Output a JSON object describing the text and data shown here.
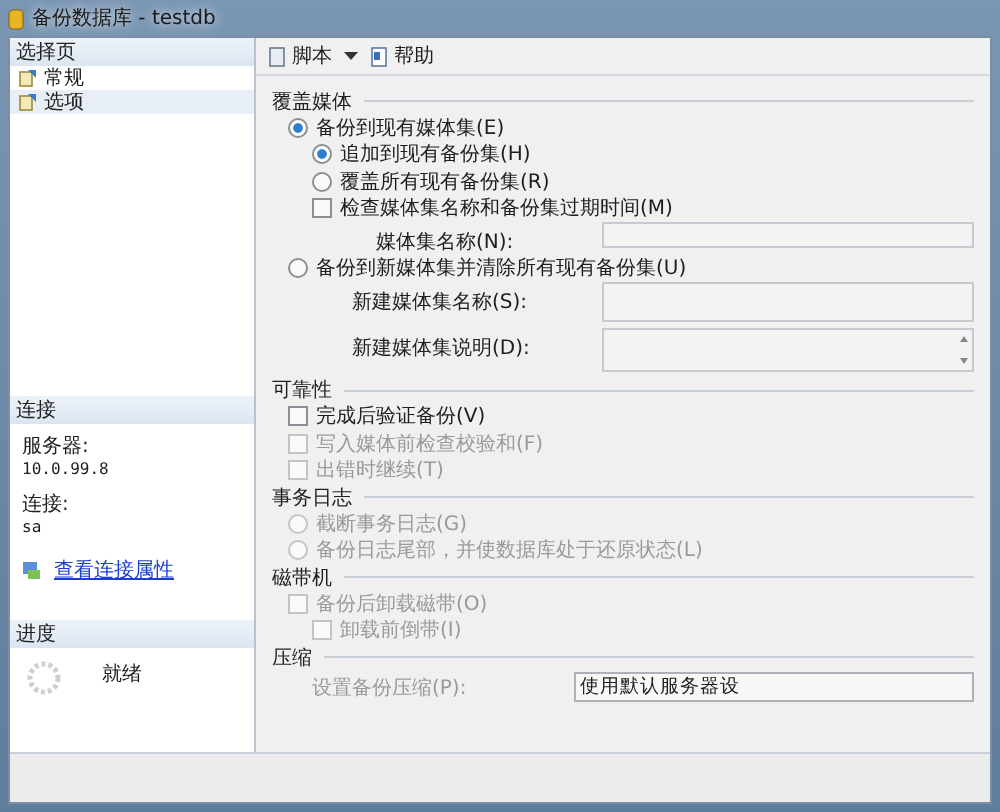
{
  "window": {
    "title": "备份数据库 - testdb"
  },
  "sidebar": {
    "header": "选择页",
    "items": [
      {
        "label": "常规",
        "selected": false
      },
      {
        "label": "选项",
        "selected": true
      }
    ]
  },
  "connection": {
    "header": "连接",
    "server_label": "服务器:",
    "server": "10.0.99.8",
    "login_label": "连接:",
    "login": "sa",
    "link": "查看连接属性"
  },
  "progress": {
    "header": "进度",
    "status": "就绪"
  },
  "toolbar": [
    {
      "label": "脚本",
      "kind": "script",
      "dropdown": true
    },
    {
      "label": "帮助",
      "kind": "help",
      "dropdown": false
    }
  ],
  "sections": [
    {
      "title": "覆盖媒体",
      "items": [
        {
          "kind": "radio",
          "label": "备份到现有媒体集(E)",
          "selected": true,
          "disabled": false,
          "children": [
            {
              "kind": "radio",
              "label": "追加到现有备份集(H)",
              "selected": true,
              "disabled": false
            },
            {
              "kind": "radio",
              "label": "覆盖所有现有备份集(R)",
              "selected": false,
              "disabled": false
            },
            {
              "kind": "checkbox",
              "label": "检查媒体集名称和备份集过期时间(M)",
              "checked": false,
              "disabled": false,
              "children": [
                {
                  "kind": "field",
                  "label": "媒体集名称(N):",
                  "disabled": true
                }
              ]
            }
          ]
        },
        {
          "kind": "radio",
          "label": "备份到新媒体集并清除所有现有备份集(U)",
          "selected": false,
          "disabled": false,
          "children": [
            {
              "kind": "field",
              "label": "新建媒体集名称(S):",
              "disabled": true,
              "tall": true
            },
            {
              "kind": "textarea",
              "label": "新建媒体集说明(D):",
              "disabled": true
            }
          ]
        }
      ]
    },
    {
      "title": "可靠性",
      "items": [
        {
          "kind": "checkbox",
          "label": "完成后验证备份(V)",
          "checked": false,
          "disabled": false
        },
        {
          "kind": "checkbox",
          "label": "写入媒体前检查校验和(F)",
          "checked": false,
          "disabled": true
        },
        {
          "kind": "checkbox",
          "label": "出错时继续(T)",
          "checked": false,
          "disabled": true
        }
      ]
    },
    {
      "title": "事务日志",
      "items": [
        {
          "kind": "radio",
          "label": "截断事务日志(G)",
          "selected": false,
          "disabled": true
        },
        {
          "kind": "radio",
          "label": "备份日志尾部，并使数据库处于还原状态(L)",
          "selected": false,
          "disabled": true
        }
      ]
    },
    {
      "title": "磁带机",
      "items": [
        {
          "kind": "checkbox",
          "label": "备份后卸载磁带(O)",
          "checked": false,
          "disabled": true,
          "children": [
            {
              "kind": "checkbox",
              "label": "卸载前倒带(I)",
              "checked": false,
              "disabled": true
            }
          ]
        }
      ]
    },
    {
      "title": "压缩",
      "items": [
        {
          "kind": "dropdown",
          "label": "设置备份压缩(P):",
          "value": "使用默认服务器设",
          "disabled": true
        }
      ]
    }
  ]
}
